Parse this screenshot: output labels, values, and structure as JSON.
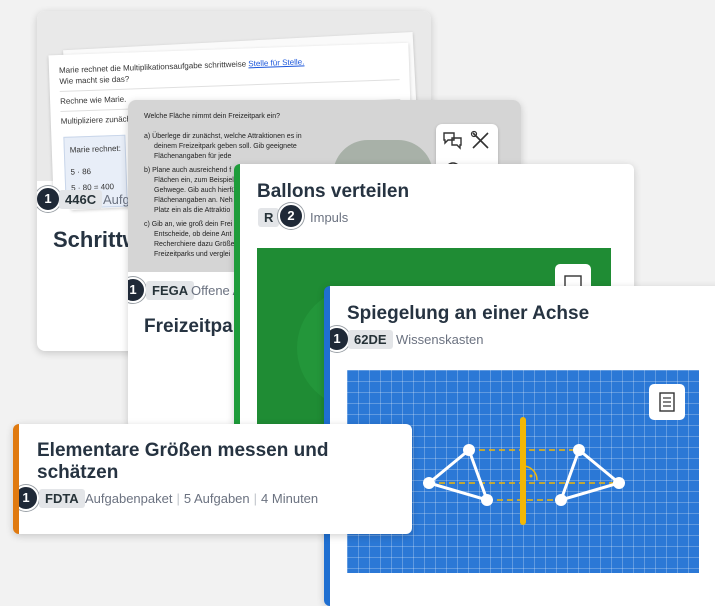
{
  "cards": {
    "c446c": {
      "code": "446C",
      "type": "Aufg",
      "title": "Schrittw",
      "badge": "1",
      "worksheet": {
        "line1": "Marie rechnet die Multiplikationsaufgabe schrittweise",
        "link": "Stelle für Stelle.",
        "line2": "Wie macht sie das?",
        "line3": "Rechne wie Marie.",
        "line4": "Multipliziere zunäch",
        "box_label": "Marie rechnet:",
        "calc1": "5 · 86",
        "calc2": "5 · 80 = 400"
      }
    },
    "fega": {
      "code": "FEGA",
      "type": "Offene A",
      "title": "Freizeitpar",
      "badge": "1",
      "worksheet": {
        "q": "Welche Fläche nimmt dein Freizeitpark ein?",
        "a1": "a) Überlege dir zunächst, welche Attraktionen es in",
        "a2": "deinem Freizeitpark geben soll. Gib geeignete",
        "a3": "Flächenangaben für jede",
        "b1": "b) Plane auch ausreichend f",
        "b2": "Flächen ein, zum Beispiel",
        "b3": "Gehwege. Gib auch hierfü",
        "b4": "Flächenangaben an. Neh",
        "b5": "Platz ein als die Attraktio",
        "c1": "c) Gib an, wie groß dein Frei",
        "c2": "Entscheide, ob deine Ant",
        "c3": "Recherchiere dazu Größe",
        "c4": "Freizeitparks und verglei"
      }
    },
    "ballons": {
      "title": "Ballons verteilen",
      "code": "R",
      "type": "Impuls",
      "badge": "2"
    },
    "spiegelung": {
      "title": "Spiegelung an einer Achse",
      "code": "62DE",
      "type": "Wissenskasten",
      "badge": "1"
    },
    "elementare": {
      "title_line1": "Elementare Größen messen und",
      "title_line2": "schätzen",
      "code": "FDTA",
      "type": "Aufgabenpaket",
      "tasks": "5 Aufgaben",
      "duration": "4 Minuten",
      "badge": "1"
    }
  },
  "colors": {
    "green_accent": "#1e9c3a",
    "blue_accent": "#1f6fd1",
    "orange_accent": "#e07a10",
    "grid_blue": "#2b78d6",
    "axis_yellow": "#f2b705"
  },
  "icons": {
    "chat": "chat-icon",
    "tools": "tools-icon",
    "book": "book-icon"
  }
}
